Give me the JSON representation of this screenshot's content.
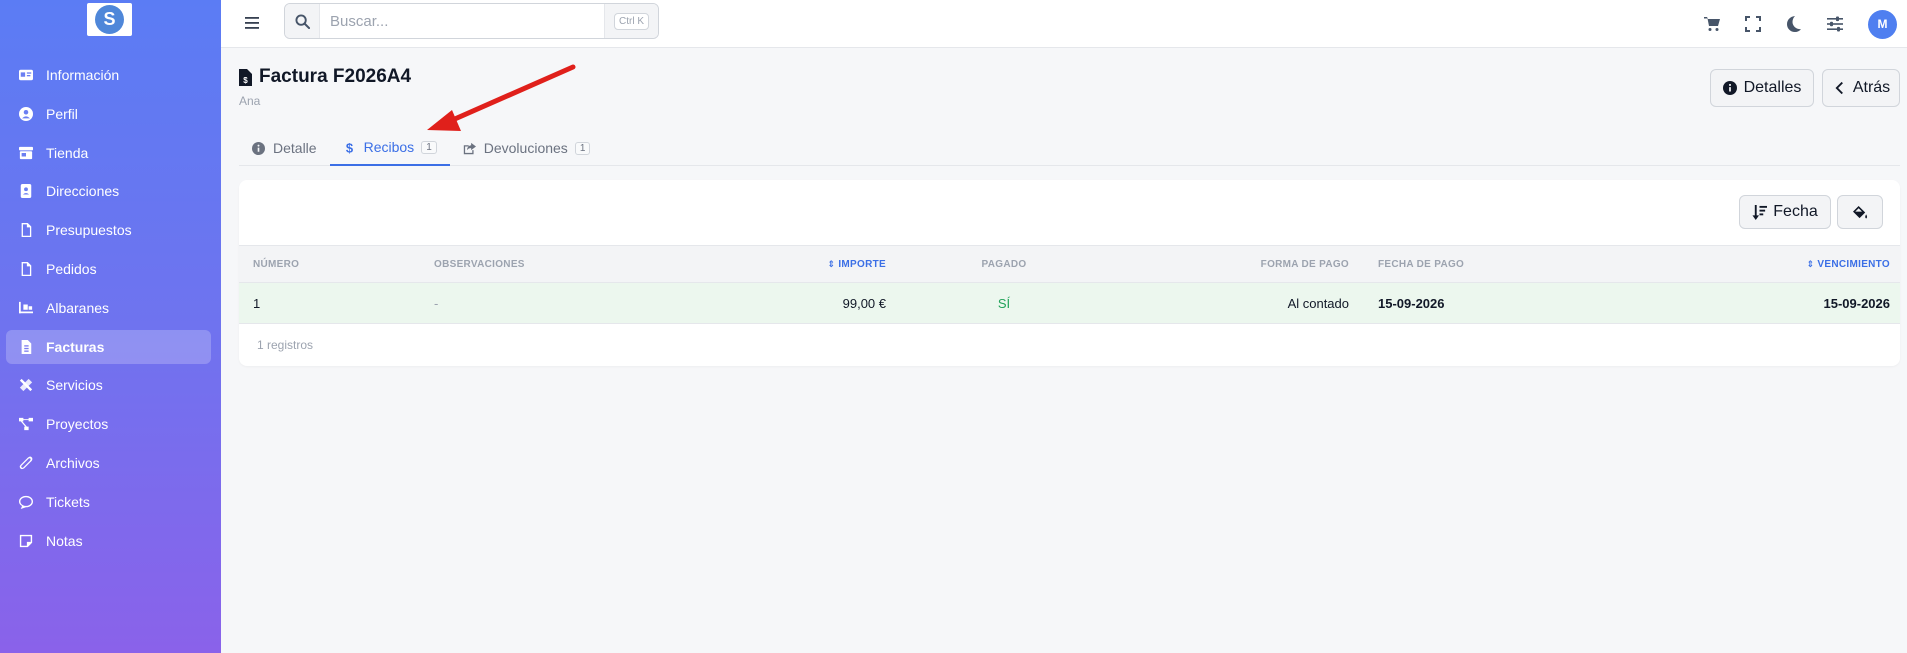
{
  "sidebar": {
    "logo_letter": "S",
    "items": [
      {
        "label": "Información",
        "icon": "id-card-icon"
      },
      {
        "label": "Perfil",
        "icon": "user-circle-icon"
      },
      {
        "label": "Tienda",
        "icon": "store-icon"
      },
      {
        "label": "Direcciones",
        "icon": "address-book-icon"
      },
      {
        "label": "Presupuestos",
        "icon": "file-icon"
      },
      {
        "label": "Pedidos",
        "icon": "file-icon"
      },
      {
        "label": "Albaranes",
        "icon": "truck-loading-icon"
      },
      {
        "label": "Facturas",
        "icon": "file-invoice-icon",
        "active": true
      },
      {
        "label": "Servicios",
        "icon": "tools-icon"
      },
      {
        "label": "Proyectos",
        "icon": "project-diagram-icon"
      },
      {
        "label": "Archivos",
        "icon": "paperclip-icon"
      },
      {
        "label": "Tickets",
        "icon": "comment-icon"
      },
      {
        "label": "Notas",
        "icon": "sticky-note-icon"
      }
    ]
  },
  "topbar": {
    "search_placeholder": "Buscar...",
    "shortcut": "Ctrl K",
    "avatar_initial": "M",
    "icons": [
      "cart-icon",
      "expand-icon",
      "moon-icon",
      "sliders-icon"
    ]
  },
  "page": {
    "title": "Factura F2026A4",
    "subtitle": "Ana",
    "details_button": "Detalles",
    "back_button": "Atrás"
  },
  "tabs": [
    {
      "label": "Detalle",
      "badge": null,
      "icon": "info-circle-icon"
    },
    {
      "label": "Recibos",
      "badge": "1",
      "icon": "dollar-icon",
      "active": true
    },
    {
      "label": "Devoluciones",
      "badge": "1",
      "icon": "share-square-icon"
    }
  ],
  "table": {
    "sort_button": "Fecha",
    "columns": {
      "numero": "NÚMERO",
      "observaciones": "OBSERVACIONES",
      "importe": "IMPORTE",
      "pagado": "PAGADO",
      "forma_pago": "FORMA DE PAGO",
      "fecha_pago": "FECHA DE PAGO",
      "vencimiento": "VENCIMIENTO"
    },
    "rows": [
      {
        "numero": "1",
        "observaciones": "-",
        "importe": "99,00 €",
        "pagado": "SÍ",
        "forma_pago": "Al contado",
        "fecha_pago": "15-09-2026",
        "vencimiento": "15-09-2026"
      }
    ],
    "footer": "1 registros"
  },
  "colors": {
    "accent": "#3b6fe6",
    "paid_row_bg": "#ecf7ee",
    "paid_text": "#22a35a",
    "annotation_arrow": "#e0201b"
  }
}
